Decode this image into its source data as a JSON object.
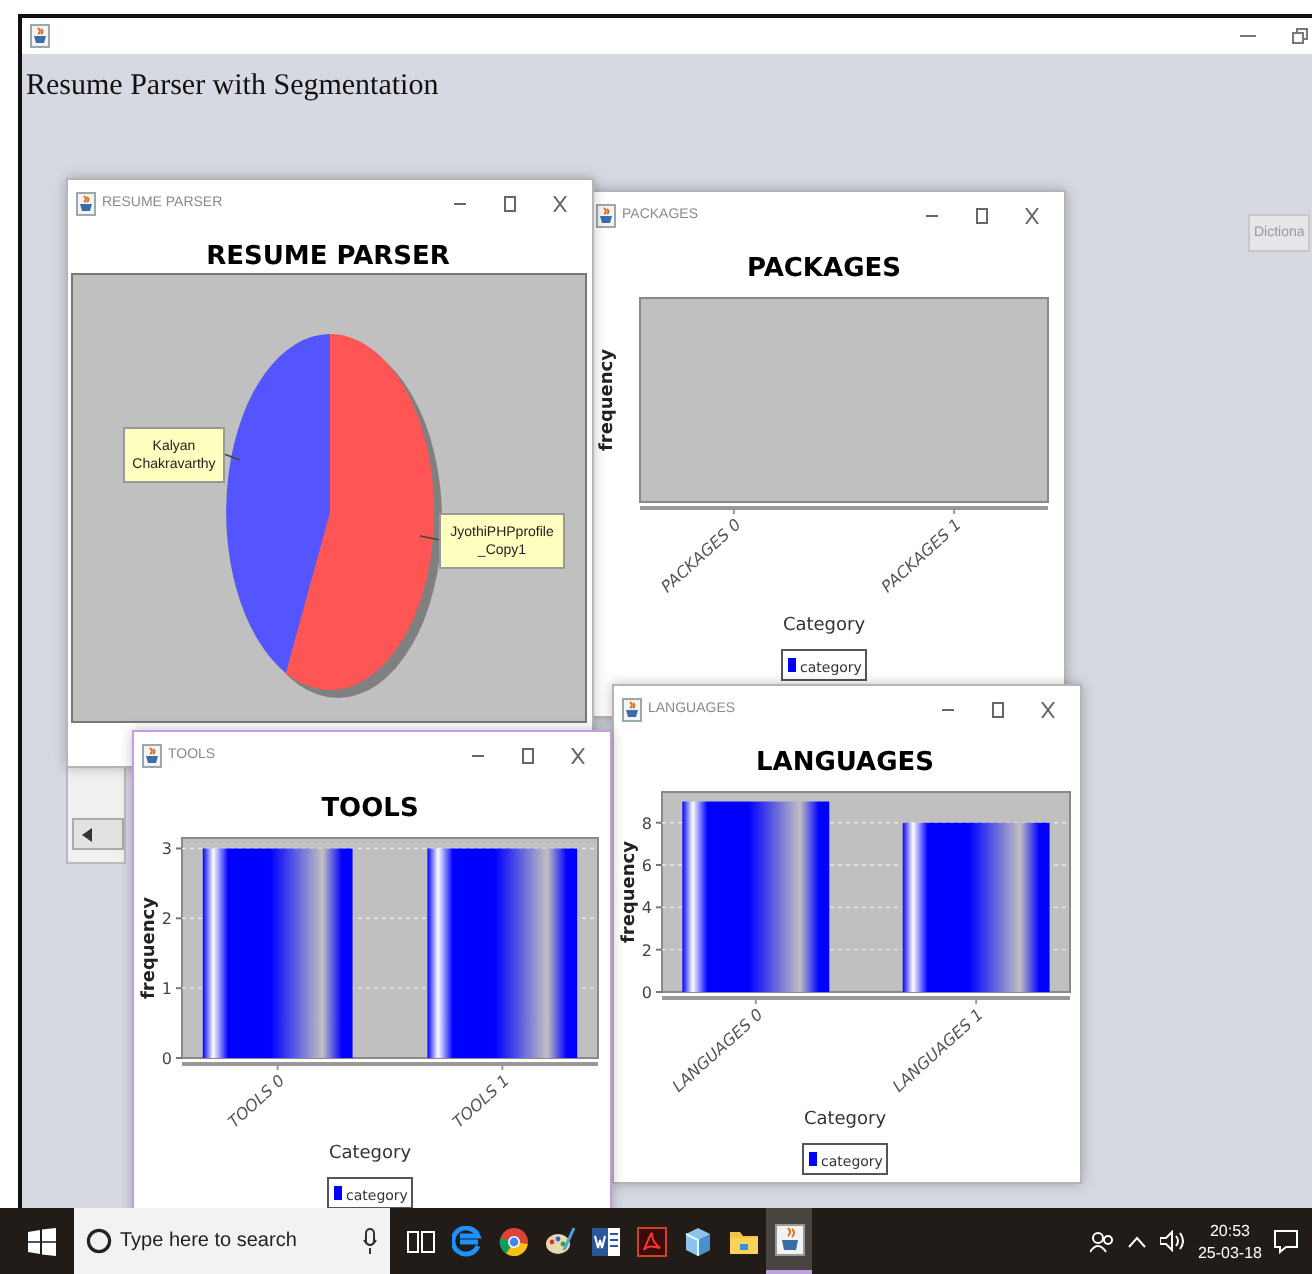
{
  "main_window": {
    "heading": "Resume Parser with Segmentation",
    "side_button": "Dictiona"
  },
  "windows": [
    {
      "kind": "bar",
      "title": "PACKAGES",
      "active": false,
      "chart_data": {
        "type": "other",
        "title": "PACKAGES",
        "xlabel": "Category",
        "ylabel": "frequency",
        "categories": [
          "PACKAGES 0",
          "PACKAGES 1"
        ],
        "series": [
          {
            "name": "category",
            "color": "#0000ff",
            "values": [
              null,
              null
            ]
          }
        ]
      }
    },
    {
      "kind": "pie",
      "title": "RESUME PARSER",
      "active": false,
      "pie": {
        "title": "RESUME PARSER",
        "slices": [
          {
            "label_lines": [
              "Kalyan",
              "Chakravarthy"
            ],
            "color": "#5555ff"
          },
          {
            "label_lines": [
              "JyothiPHPprofile",
              "_Copy1"
            ],
            "color": "#ff5555"
          }
        ]
      }
    },
    {
      "kind": "bar",
      "title": "LANGUAGES",
      "active": false,
      "chart_data": {
        "type": "bar",
        "title": "LANGUAGES",
        "xlabel": "Category",
        "ylabel": "frequency",
        "categories": [
          "LANGUAGES 0",
          "LANGUAGES 1"
        ],
        "series": [
          {
            "name": "category",
            "color": "#0000ff",
            "values": [
              9,
              8
            ]
          }
        ],
        "ylim": [
          0,
          9.45
        ],
        "yticks": [
          0,
          2,
          4,
          6,
          8
        ],
        "grid": true
      }
    },
    {
      "kind": "bar",
      "title": "TOOLS",
      "active": true,
      "chart_data": {
        "type": "bar",
        "title": "TOOLS",
        "xlabel": "Category",
        "ylabel": "frequency",
        "categories": [
          "TOOLS 0",
          "TOOLS 1"
        ],
        "series": [
          {
            "name": "category",
            "color": "#0000ff",
            "values": [
              3,
              3
            ]
          }
        ],
        "ylim": [
          0,
          3.15
        ],
        "yticks": [
          0,
          1,
          2,
          3
        ],
        "grid": true
      }
    }
  ],
  "taskbar": {
    "search": {
      "placeholder": "Type here to search"
    },
    "apps": [
      {
        "kind": "taskview",
        "selected": false
      },
      {
        "kind": "edge",
        "selected": false
      },
      {
        "kind": "chrome",
        "selected": false
      },
      {
        "kind": "paint",
        "selected": false
      },
      {
        "kind": "word",
        "selected": false
      },
      {
        "kind": "acrobat",
        "selected": false
      },
      {
        "kind": "cube",
        "selected": false
      },
      {
        "kind": "folder",
        "selected": false
      },
      {
        "kind": "java",
        "selected": true
      }
    ],
    "time": "20:53",
    "date": "25-03-18"
  }
}
